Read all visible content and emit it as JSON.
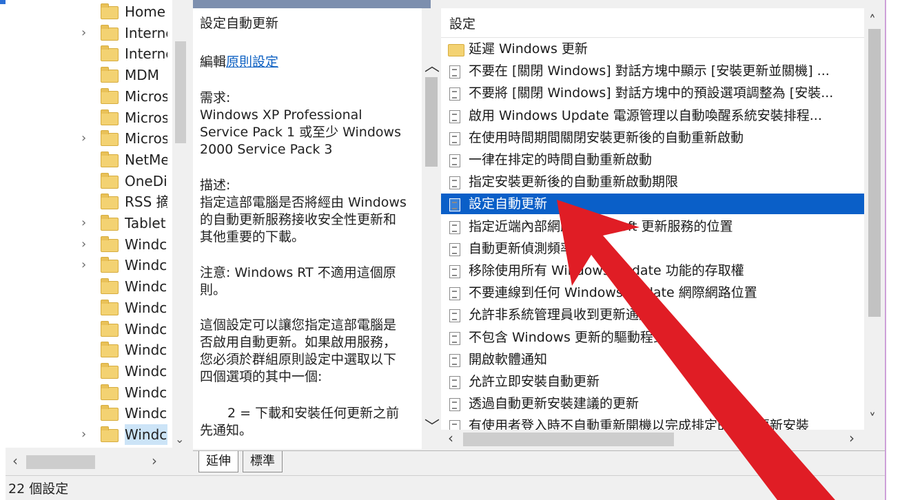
{
  "tree": {
    "items": [
      {
        "label": "Home",
        "expandable": false
      },
      {
        "label": "Interne",
        "expandable": true
      },
      {
        "label": "Interne",
        "expandable": false
      },
      {
        "label": "MDM",
        "expandable": false
      },
      {
        "label": "Micros",
        "expandable": false
      },
      {
        "label": "Micros",
        "expandable": false
      },
      {
        "label": "Micros",
        "expandable": true
      },
      {
        "label": "NetMe",
        "expandable": false
      },
      {
        "label": "OneDi",
        "expandable": false
      },
      {
        "label": "RSS 摘",
        "expandable": false
      },
      {
        "label": "Tablet",
        "expandable": true
      },
      {
        "label": "Windc",
        "expandable": true
      },
      {
        "label": "Windc",
        "expandable": true
      },
      {
        "label": "Windc",
        "expandable": false
      },
      {
        "label": "Windc",
        "expandable": false
      },
      {
        "label": "Windc",
        "expandable": false
      },
      {
        "label": "Windc",
        "expandable": false
      },
      {
        "label": "Windc",
        "expandable": false
      },
      {
        "label": "Windc",
        "expandable": false
      },
      {
        "label": "Windc",
        "expandable": false
      },
      {
        "label": "Windc",
        "expandable": true,
        "selected": true
      }
    ]
  },
  "description": {
    "title": "設定自動更新",
    "edit_prefix": "編輯",
    "edit_link": "原則設定",
    "req_label": "需求:",
    "req_text": "Windows XP Professional Service Pack 1 或至少 Windows 2000 Service Pack 3",
    "desc_label": "描述:",
    "desc_text": "指定這部電腦是否將經由 Windows 的自動更新服務接收安全性更新和其他重要的下載。",
    "note_text": "注意: Windows RT 不適用這個原則。",
    "body_text": "這個設定可以讓您指定這部電腦是否啟用自動更新。如果啟用服務，您必須於群組原則設定中選取以下四個選項的其中一個:",
    "option_text": "2 = 下載和安裝任何更新之前先通知。"
  },
  "settings": {
    "header": "設定",
    "rows": [
      {
        "label": "延遲 Windows 更新",
        "type": "folder"
      },
      {
        "label": "不要在 [關閉 Windows] 對話方塊中顯示 [安裝更新並關機] ...",
        "type": "policy"
      },
      {
        "label": "不要將 [關閉 Windows] 對話方塊中的預設選項調整為 [安裝...",
        "type": "policy"
      },
      {
        "label": "啟用 Windows Update 電源管理以自動喚醒系統安裝排程...",
        "type": "policy"
      },
      {
        "label": "在使用時間期間關閉安裝更新後的自動重新啟動",
        "type": "policy"
      },
      {
        "label": "一律在排定的時間自動重新啟動",
        "type": "policy"
      },
      {
        "label": "指定安裝更新後的自動重新啟動期限",
        "type": "policy"
      },
      {
        "label": "設定自動更新",
        "type": "policy",
        "selected": true
      },
      {
        "label": "指定近端內部網路 Microsoft 更新服務的位置",
        "type": "policy"
      },
      {
        "label": "自動更新偵測頻率",
        "type": "policy"
      },
      {
        "label": "移除使用所有 Windows Update 功能的存取權",
        "type": "policy"
      },
      {
        "label": "不要連線到任何 Windows Update 網際網路位置",
        "type": "policy"
      },
      {
        "label": "允許非系統管理員收到更新通知",
        "type": "policy"
      },
      {
        "label": "不包含 Windows 更新的驅動程式",
        "type": "policy"
      },
      {
        "label": "開啟軟體通知",
        "type": "policy"
      },
      {
        "label": "允許立即安裝自動更新",
        "type": "policy"
      },
      {
        "label": "透過自動更新安裝建議的更新",
        "type": "policy"
      },
      {
        "label": "有使用者登入時不自動重新開機以完成排定的自動更新安裝",
        "type": "policy"
      }
    ]
  },
  "tabs": {
    "extended": "延伸",
    "standard": "標準"
  },
  "status": {
    "count": "22 個設定"
  },
  "colors": {
    "selection": "#0a5fc8",
    "arrow": "#e01d25",
    "folder": "#f3d272"
  }
}
